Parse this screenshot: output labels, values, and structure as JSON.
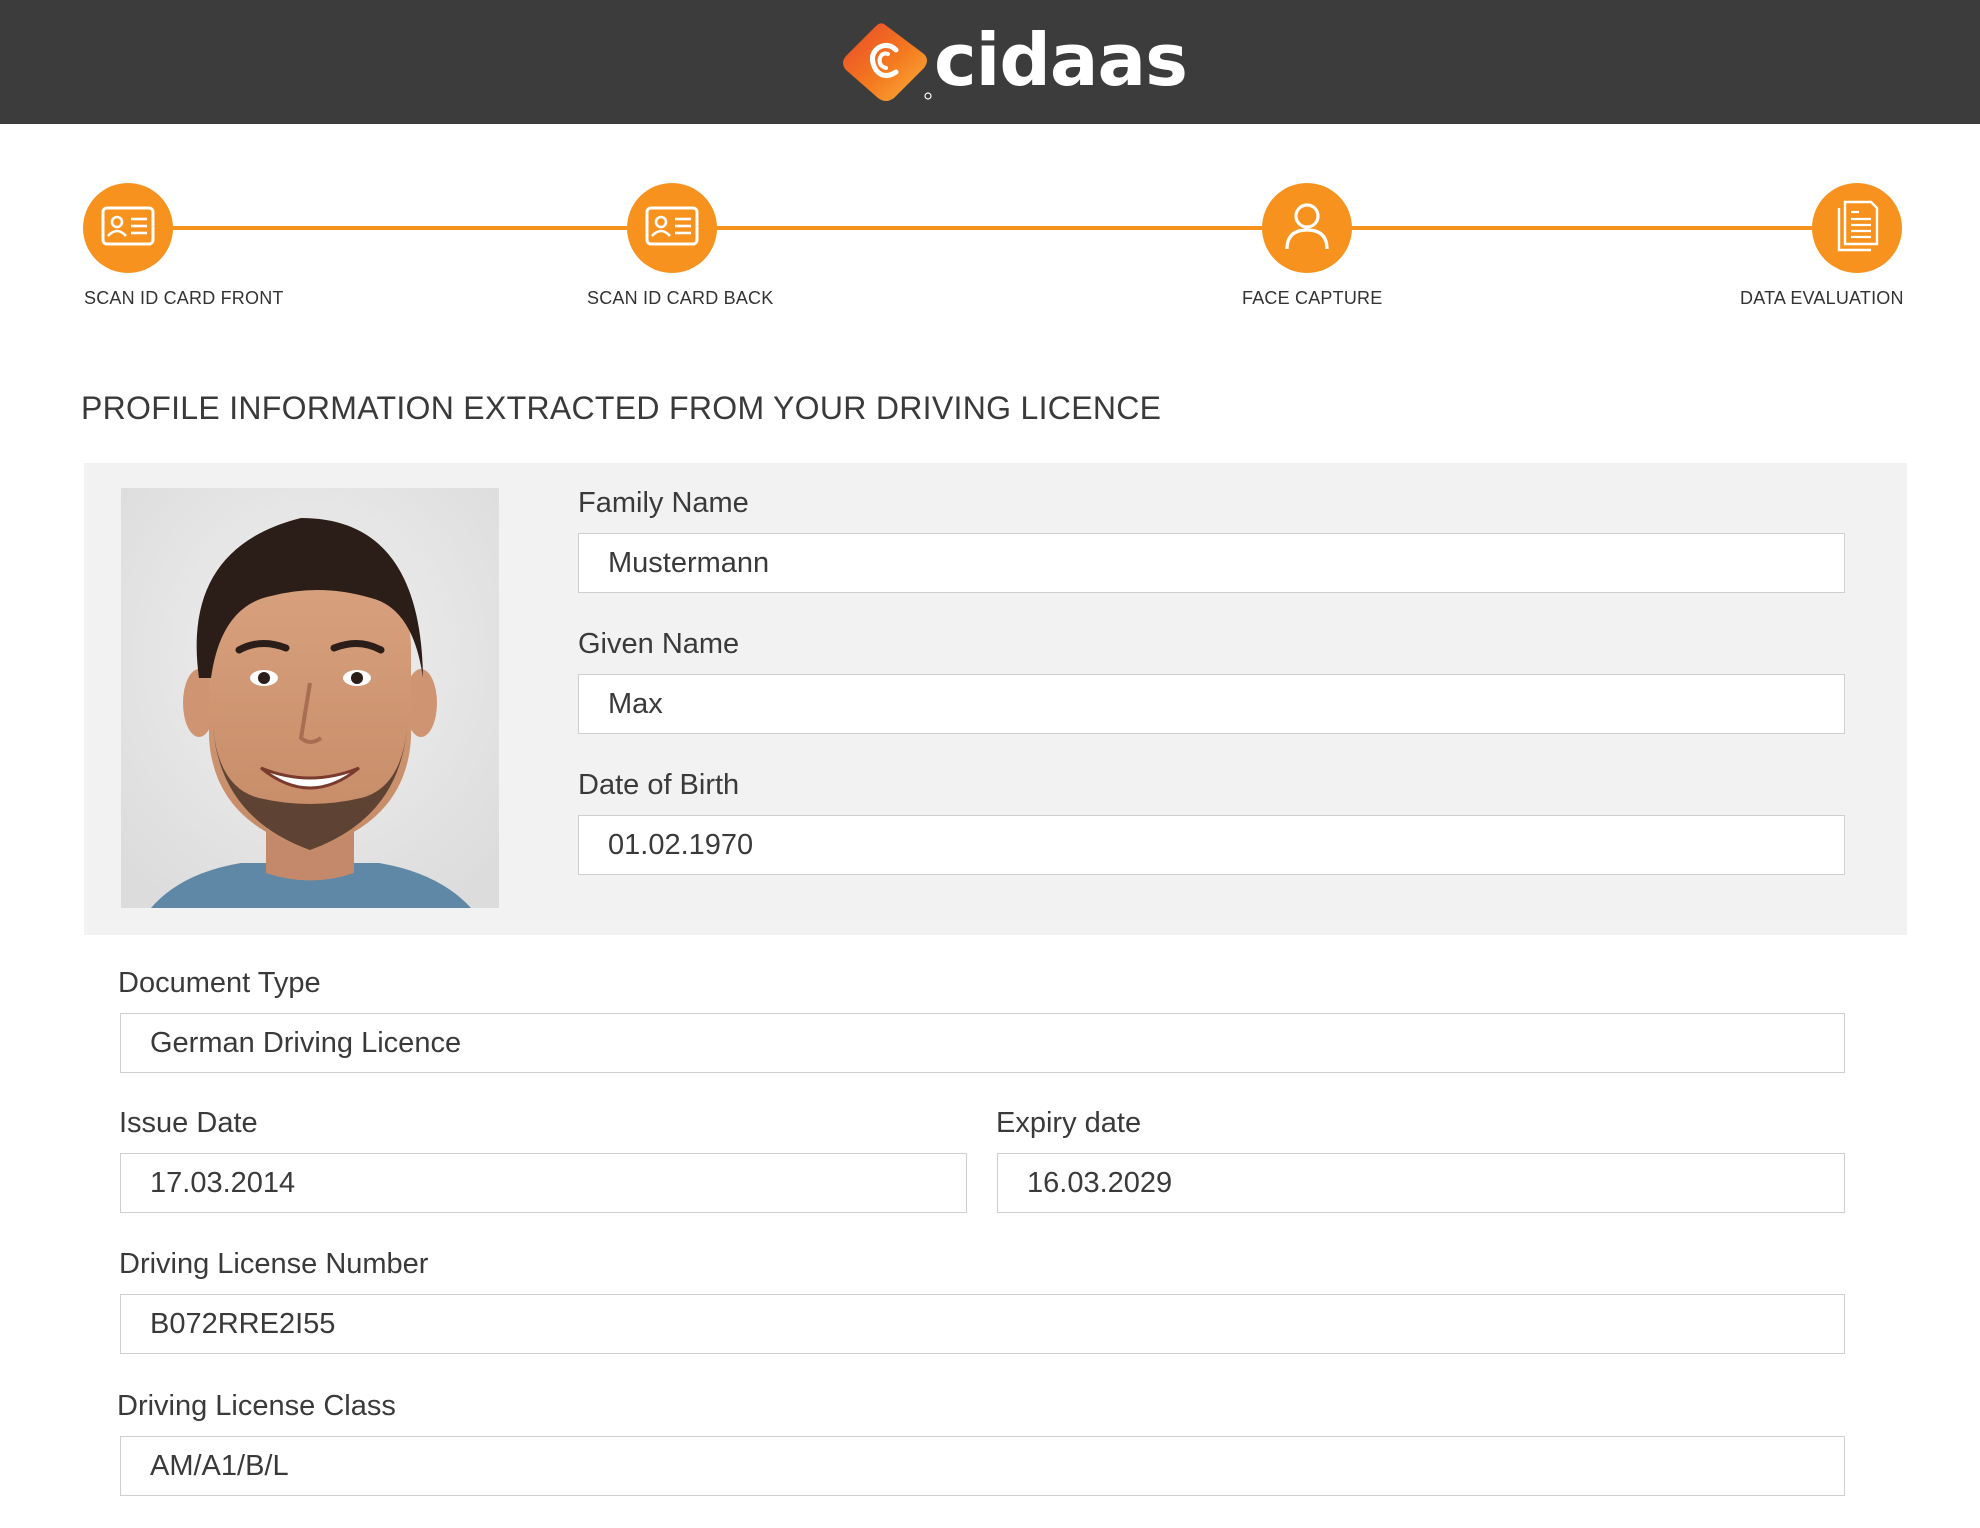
{
  "header": {
    "brand_name": "cidaas",
    "colors": {
      "background": "#3c3c3c",
      "logo_orange": "#f7921e",
      "logo_red": "#e8472a"
    }
  },
  "stepper": {
    "accent_color": "#f7921e",
    "steps": [
      {
        "label": "SCAN ID CARD FRONT",
        "icon": "id-card-icon"
      },
      {
        "label": "SCAN ID CARD BACK",
        "icon": "id-card-icon"
      },
      {
        "label": "FACE CAPTURE",
        "icon": "person-icon"
      },
      {
        "label": "DATA EVALUATION",
        "icon": "document-icon"
      }
    ]
  },
  "main": {
    "title": "PROFILE INFORMATION EXTRACTED FROM YOUR DRIVING LICENCE",
    "fields": {
      "family_name": {
        "label": "Family Name",
        "value": "Mustermann"
      },
      "given_name": {
        "label": "Given Name",
        "value": "Max"
      },
      "date_of_birth": {
        "label": "Date of Birth",
        "value": "01.02.1970"
      },
      "document_type": {
        "label": "Document Type",
        "value": "German Driving Licence"
      },
      "issue_date": {
        "label": "Issue Date",
        "value": "17.03.2014"
      },
      "expiry_date": {
        "label": "Expiry date",
        "value": "16.03.2029"
      },
      "license_number": {
        "label": "Driving License Number",
        "value": "B072RRE2I55"
      },
      "license_class": {
        "label": "Driving License Class",
        "value": "AM/A1/B/L"
      }
    }
  }
}
